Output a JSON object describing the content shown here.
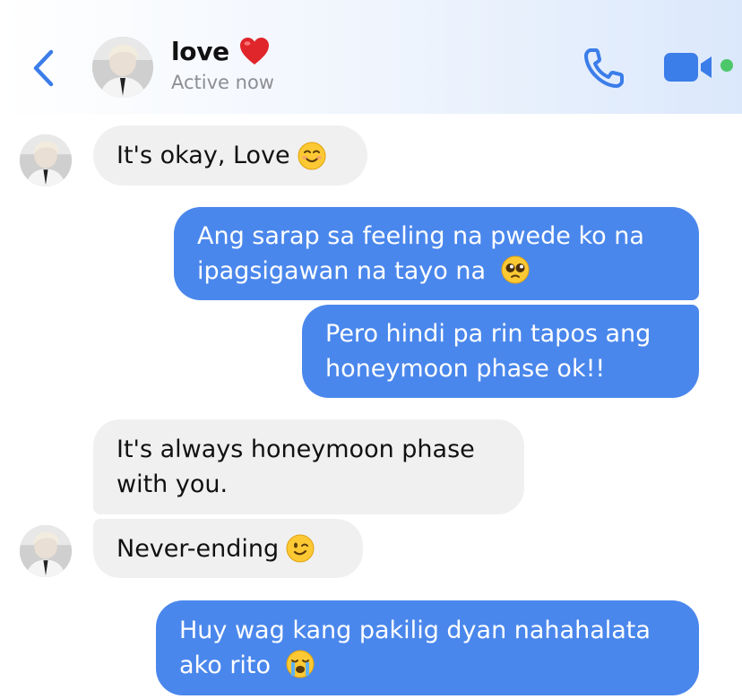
{
  "header": {
    "contact_name": "love",
    "status": "Active now",
    "name_emoji": "red-heart",
    "colors": {
      "accent": "#3b7de9",
      "active_dot": "#4cc86a"
    }
  },
  "messages": [
    {
      "side": "incoming",
      "text": "It's okay, Love",
      "emoji": "smiling-face"
    },
    {
      "side": "outgoing",
      "text": "Ang sarap sa feeling na pwede ko na ipagsigawan na tayo na",
      "emoji": "pleading-face"
    },
    {
      "side": "outgoing",
      "text": "Pero hindi pa rin tapos ang honeymoon phase ok!!",
      "emoji": ""
    },
    {
      "side": "incoming",
      "text": "It's always honeymoon phase with you.",
      "emoji": ""
    },
    {
      "side": "incoming",
      "text": "Never-ending",
      "emoji": "winking-face"
    },
    {
      "side": "outgoing",
      "text": "Huy wag kang pakilig dyan nahahalata ako rito",
      "emoji": "loudly-crying-face"
    }
  ],
  "colors": {
    "outgoing_bubble": "#4a87ec",
    "incoming_bubble": "#f0f0f0"
  }
}
